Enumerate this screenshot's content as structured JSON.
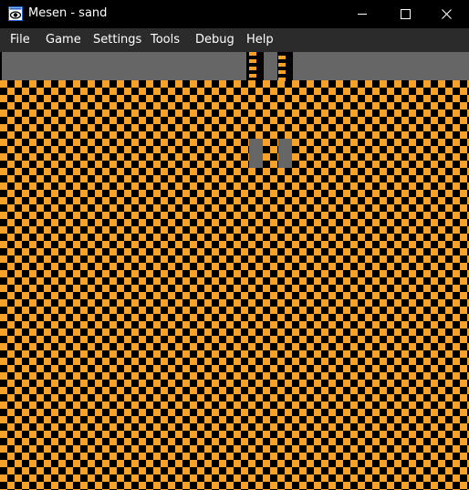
{
  "window": {
    "title": "Mesen - sand",
    "app_icon": "mesen-eye-icon",
    "controls": {
      "minimize_icon": "minimize-icon",
      "maximize_icon": "maximize-icon",
      "close_icon": "close-icon"
    }
  },
  "menu": {
    "items": [
      {
        "label": "File"
      },
      {
        "label": "Game"
      },
      {
        "label": "Settings"
      },
      {
        "label": "Tools"
      },
      {
        "label": "Debug"
      },
      {
        "label": "Help"
      }
    ]
  },
  "game_screen": {
    "content": "checkerboard-tile-pattern",
    "colors": {
      "background": "#000000",
      "tile": "#f5a22b",
      "gray_block": "#666666",
      "menubar": "#2b2b2b"
    }
  }
}
